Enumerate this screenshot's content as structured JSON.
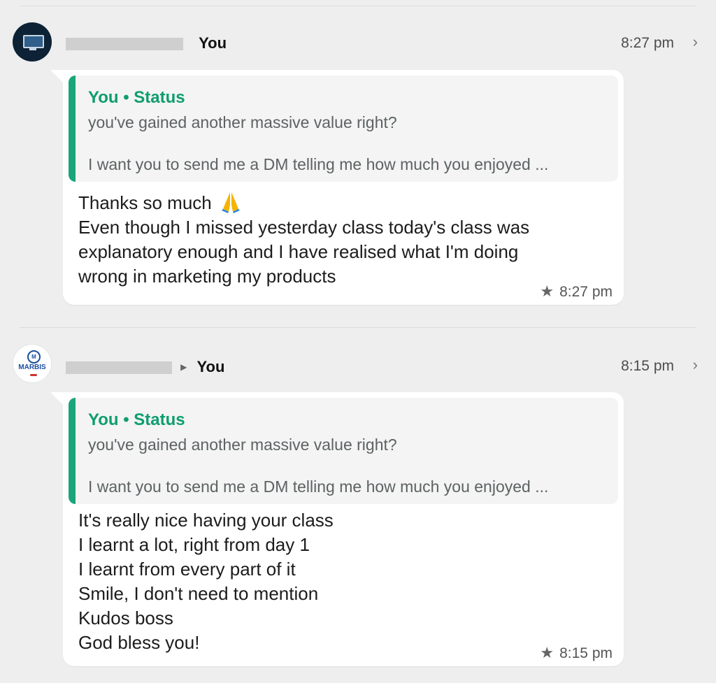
{
  "messages": [
    {
      "sender_visible": "You",
      "time": "8:27 pm",
      "quote": {
        "title": "You • Status",
        "line1": "you've gained another massive value right?",
        "line2": "I want you to send me a  DM telling me how much you enjoyed ..."
      },
      "lines": [
        "Thanks so much",
        "Even though I missed yesterday class today's class was",
        "explanatory enough and I have realised what I'm doing",
        "wrong in marketing my products"
      ],
      "footer_time": "8:27 pm"
    },
    {
      "sender_visible": "You",
      "time": "8:15 pm",
      "avatar_brand": "MARBIS",
      "quote": {
        "title": "You • Status",
        "line1": "you've gained another massive value right?",
        "line2": "I want you to send me a  DM telling me how much you enjoyed ..."
      },
      "lines": [
        "It's really nice having your class",
        "I learnt a lot, right from day 1",
        "I learnt from every part of it",
        "Smile, I don't need to mention",
        "Kudos boss",
        "God bless you!"
      ],
      "footer_time": "8:15 pm"
    }
  ],
  "icons": {
    "chevron": "chevron-right-icon",
    "star": "star-icon",
    "emoji": "folded-hands-emoji"
  }
}
